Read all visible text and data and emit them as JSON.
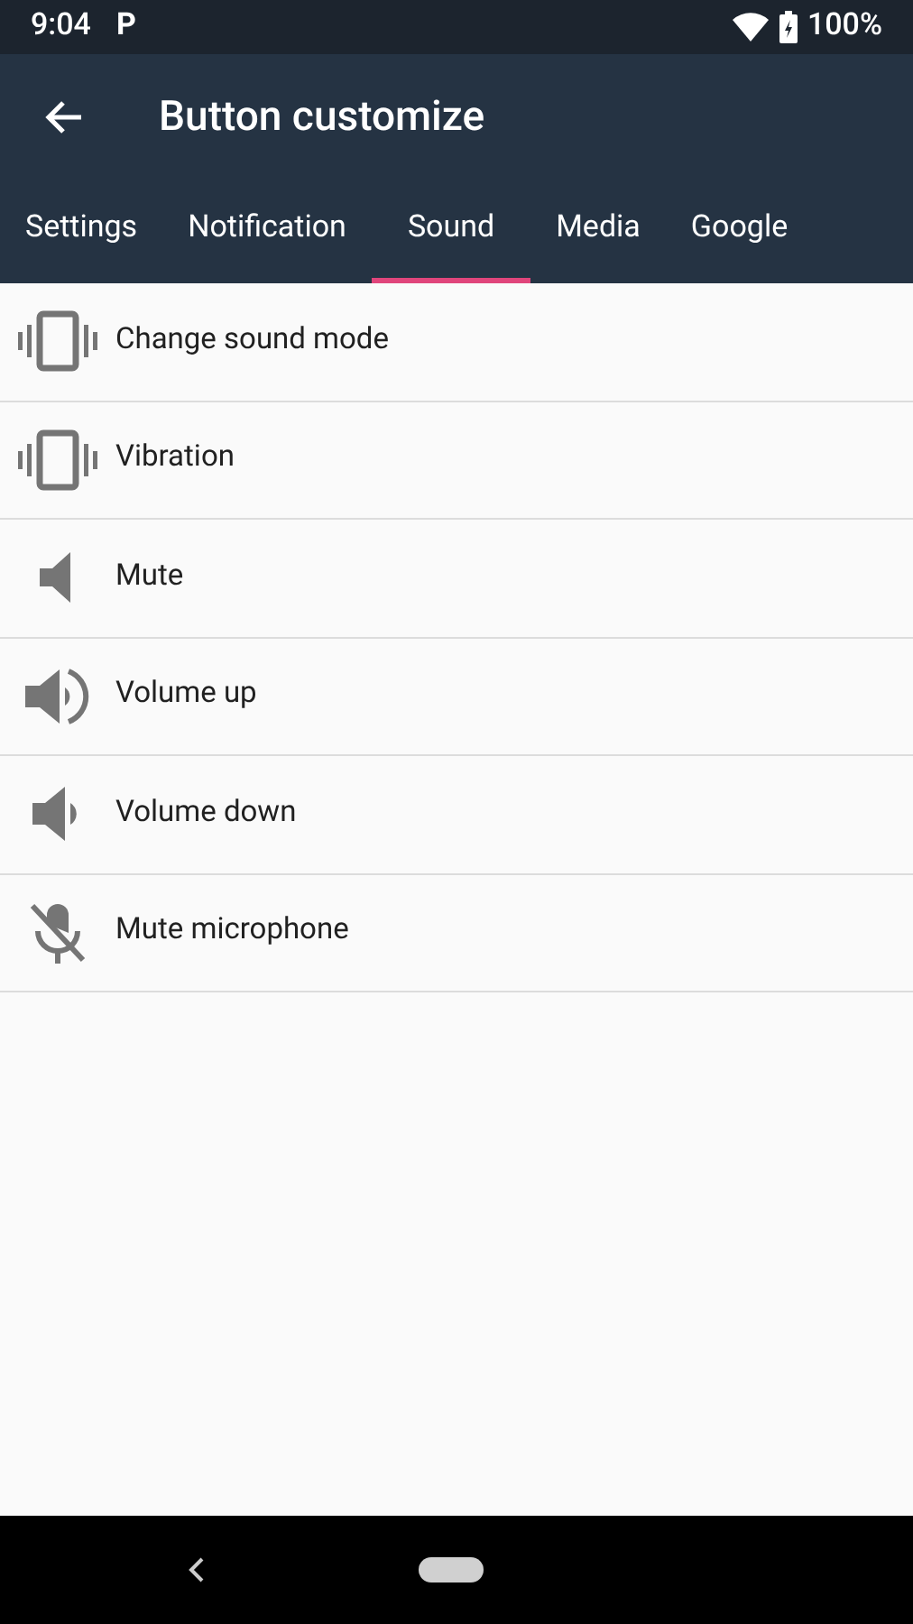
{
  "status_bar": {
    "time": "9:04",
    "app_badge": "P",
    "battery": "100%"
  },
  "app_bar": {
    "title": "Button customize"
  },
  "tabs": [
    {
      "label": "Settings",
      "selected": false
    },
    {
      "label": "Notification",
      "selected": false
    },
    {
      "label": "Sound",
      "selected": true
    },
    {
      "label": "Media",
      "selected": false
    },
    {
      "label": "Google",
      "selected": false
    }
  ],
  "items": [
    {
      "label": "Change sound mode",
      "kind": "vibrate"
    },
    {
      "label": "Vibration",
      "kind": "vibrate"
    },
    {
      "label": "Mute",
      "kind": "mute"
    },
    {
      "label": "Volume up",
      "kind": "volume_up"
    },
    {
      "label": "Volume down",
      "kind": "volume_down"
    },
    {
      "label": "Mute microphone",
      "kind": "mic_off"
    }
  ]
}
